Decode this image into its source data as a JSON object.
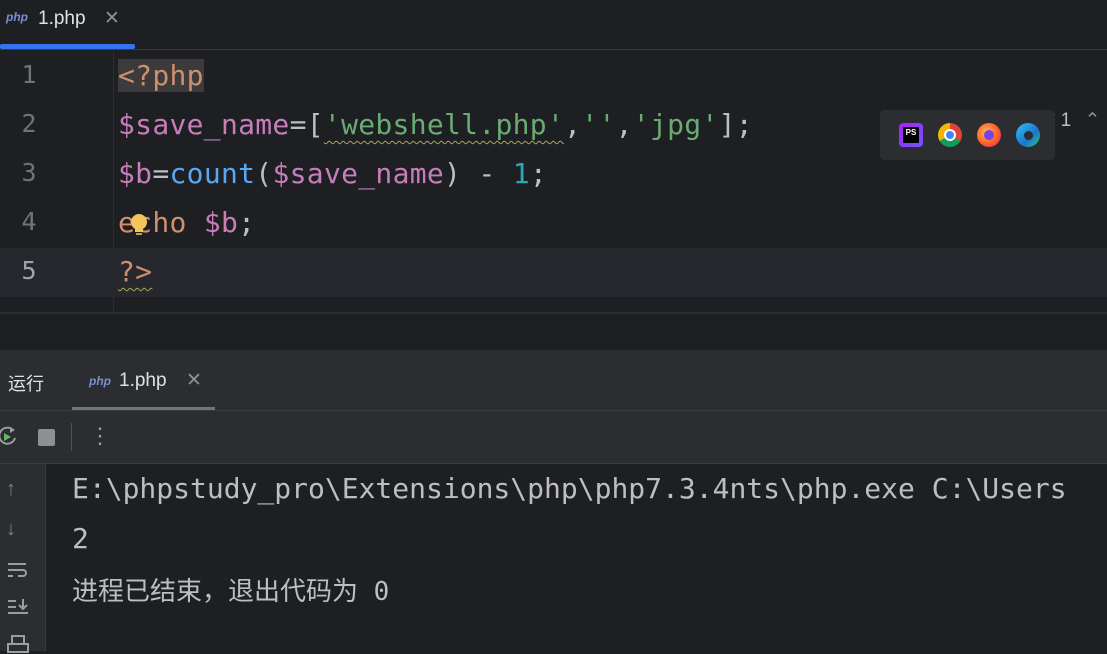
{
  "editor_tab": {
    "icon": "php-file-icon",
    "icon_text": "php",
    "label": "1.php",
    "close": "✕"
  },
  "editor": {
    "lines": [
      {
        "num": "1"
      },
      {
        "num": "2"
      },
      {
        "num": "3"
      },
      {
        "num": "4"
      },
      {
        "num": "5"
      }
    ],
    "code": {
      "l1": "<?php",
      "l2_var": "$save_name",
      "l2_eq": "=[",
      "l2_s1": "'webshell.php'",
      "l2_c1": ",",
      "l2_s2": "''",
      "l2_c2": ",",
      "l2_s3": "'jpg'",
      "l2_end": "];",
      "l3_var": "$b",
      "l3_eq": "=",
      "l3_fn": "count",
      "l3_open": "(",
      "l3_arg": "$save_name",
      "l3_close": ") - ",
      "l3_num": "1",
      "l3_end": ";",
      "l4_kw": "echo",
      "l4_var": "$b",
      "l4_end": ";",
      "l5": "?>"
    },
    "current_line": 5
  },
  "inspections": {
    "warnings": "1",
    "weak_warnings": "1"
  },
  "browsers": [
    "phpstorm-icon",
    "chrome-icon",
    "firefox-icon",
    "edge-icon"
  ],
  "run_panel": {
    "title": "运行",
    "tab": {
      "icon_text": "php",
      "label": "1.php",
      "close": "✕"
    },
    "toolbar": {
      "more": "⋮"
    },
    "console": [
      "E:\\phpstudy_pro\\Extensions\\php\\php7.3.4nts\\php.exe C:\\Users",
      "2",
      "进程已结束，退出代码为 0"
    ]
  },
  "colors": {
    "accent": "#3574f0",
    "keyword": "#cf8e6d",
    "variable": "#c77dbb",
    "string": "#6aab73",
    "function": "#56a8f5",
    "number": "#2aacb8"
  }
}
